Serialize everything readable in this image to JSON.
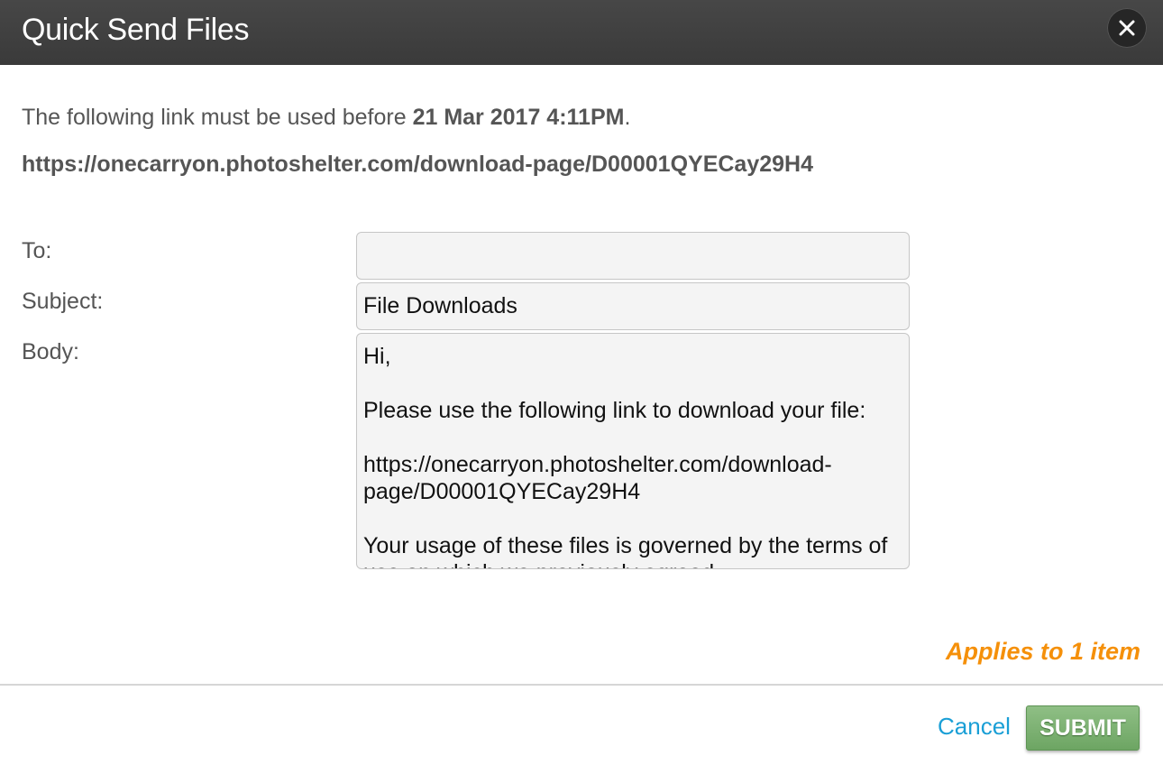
{
  "header": {
    "title": "Quick Send Files",
    "close_icon": "close-icon"
  },
  "notice": {
    "prefix": "The following link must be used before ",
    "expiry": "21 Mar 2017 4:11PM",
    "suffix": "."
  },
  "link_url": "https://onecarryon.photoshelter.com/download-page/D00001QYECay29H4",
  "form": {
    "to_label": "To:",
    "to_value": "",
    "subject_label": "Subject:",
    "subject_value": "File Downloads",
    "body_label": "Body:",
    "body_value": "Hi,\n\nPlease use the following link to download your file:\n\nhttps://onecarryon.photoshelter.com/download-page/D00001QYECay29H4\n\nYour usage of these files is governed by the terms of use on which we previously agreed."
  },
  "footer": {
    "applies": "Applies to 1 item",
    "cancel_label": "Cancel",
    "submit_label": "SUBMIT"
  },
  "colors": {
    "header_bg": "#3f3f3f",
    "accent_orange": "#f5900a",
    "link_blue": "#1a9fd6",
    "submit_green": "#7db173"
  }
}
